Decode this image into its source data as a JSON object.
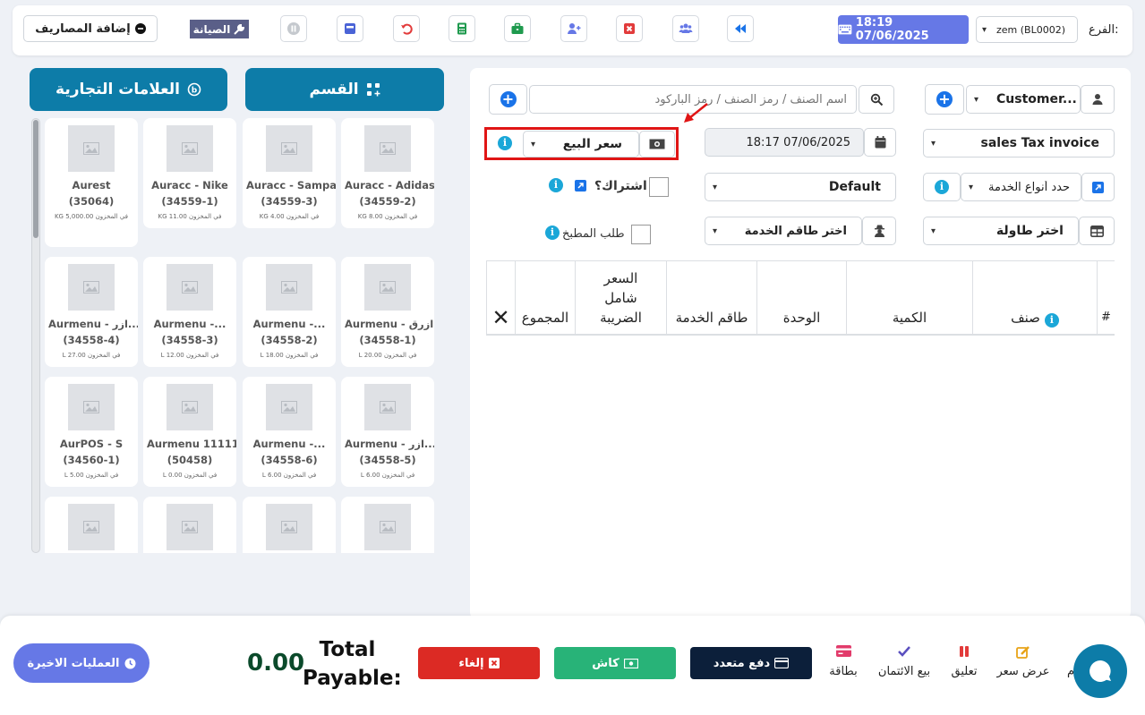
{
  "header": {
    "add_expenses_label": "إضافة المصاريف",
    "maintenance_label": "الصيانة",
    "datetime": "18:19 07/06/2025",
    "branch_label": "الفرع:",
    "branch_value": "zem (BL0002)",
    "icons": [
      "pause-icon",
      "register-icon",
      "undo-icon",
      "calculator-icon",
      "briefcase-icon",
      "add-user-icon",
      "close-box-icon",
      "users-icon",
      "rewind-icon"
    ]
  },
  "catalog": {
    "brands_label": "العلامات التجارية",
    "section_label": "القسم",
    "products": [
      {
        "name": "Aurest",
        "code": "(35064)",
        "stock": "KG 5,000.00 في المخزون"
      },
      {
        "name": "Auracc - Nike",
        "code": "(34559-1)",
        "stock": "KG 11.00 في المخزون"
      },
      {
        "name": "Auracc - Sampa",
        "code": "(34559-3)",
        "stock": "KG 4.00 في المخزون"
      },
      {
        "name": "Auracc - Adidas",
        "code": "(34559-2)",
        "stock": "KG 8.00 في المخزون"
      },
      {
        "name": "Aurmenu - ازر...",
        "code": "(34558-4)",
        "stock": "L 27.00 في المخزون"
      },
      {
        "name": "Aurmenu -...",
        "code": "(34558-3)",
        "stock": "L 12.00 في المخزون"
      },
      {
        "name": "Aurmenu -...",
        "code": "(34558-2)",
        "stock": "L 18.00 في المخزون"
      },
      {
        "name": "Aurmenu - ازرق",
        "code": "(34558-1)",
        "stock": "L 20.00 في المخزون"
      },
      {
        "name": "AurPOS - S",
        "code": "(34560-1)",
        "stock": "L 5.00 في المخزون"
      },
      {
        "name": "Aurmenu 11111",
        "code": "(50458)",
        "stock": "L 0.00 في المخزون"
      },
      {
        "name": "Aurmenu -...",
        "code": "(34558-6)",
        "stock": "L 6.00 في المخزون"
      },
      {
        "name": "Aurmenu - ازر...",
        "code": "(34558-5)",
        "stock": "L 6.00 في المخزون"
      },
      {
        "name": "",
        "code": "",
        "stock": ""
      },
      {
        "name": "",
        "code": "",
        "stock": ""
      },
      {
        "name": "",
        "code": "",
        "stock": ""
      },
      {
        "name": "",
        "code": "",
        "stock": ""
      }
    ]
  },
  "form": {
    "customer": "Customer...",
    "search_placeholder": "اسم الصنف / رمز الصنف / رمز الباركود",
    "invoice_type": "sales Tax invoice",
    "datetime": "18:17 07/06/2025",
    "price_list": "سعر البيع",
    "service_types": "حدد أنواع الخدمة",
    "default_value": "Default",
    "subscription_label": "اشتراك؟",
    "table_select": "اختر طاولة",
    "service_staff": "اختر طاقم الخدمة",
    "kitchen_order_label": "طلب المطبخ"
  },
  "table": {
    "headers": {
      "num": "#",
      "item": "صنف",
      "qty": "الكمية",
      "unit": "الوحدة",
      "staff": "طاقم الخدمة",
      "price": "السعر شامل الضريبة",
      "total": "المجموع"
    }
  },
  "footer": {
    "recent_transactions": "العمليات الاخيرة",
    "total_payable_label": "Total Payable:",
    "total_payable": "0.00",
    "cancel": "إلغاء",
    "cash": "كاش",
    "multi_pay": "دفع متعدد",
    "card": "بطاقة",
    "credit_sale": "بيع الائتمان",
    "suspend": "تعليق",
    "quotation": "عرض سعر",
    "draft_partial": "م",
    "colors": {
      "cancel": "#dc2a24",
      "cash": "#28b378",
      "multi": "#0c1f3a",
      "recent": "#6678e6",
      "total": "#0b4a2b"
    }
  }
}
